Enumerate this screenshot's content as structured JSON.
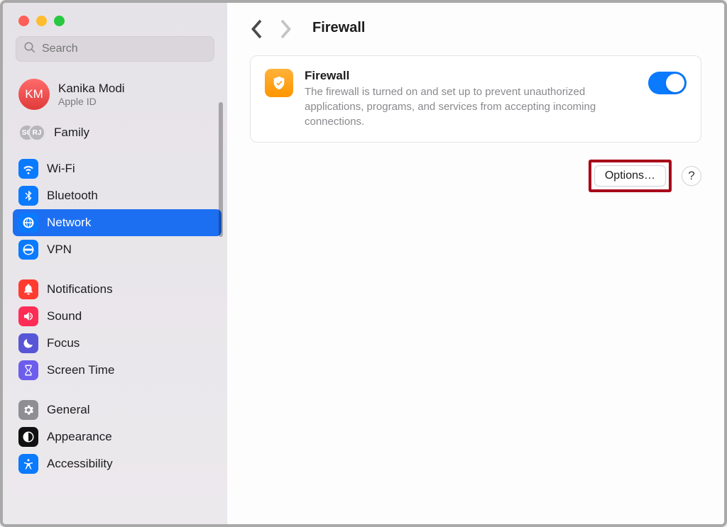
{
  "search": {
    "placeholder": "Search"
  },
  "account": {
    "initials": "KM",
    "name": "Kanika Modi",
    "sub": "Apple ID"
  },
  "family": {
    "label": "Family",
    "badge1": "SG",
    "badge2": "RJ"
  },
  "sidebar": {
    "items": [
      {
        "label": "Wi-Fi"
      },
      {
        "label": "Bluetooth"
      },
      {
        "label": "Network"
      },
      {
        "label": "VPN"
      },
      {
        "label": "Notifications"
      },
      {
        "label": "Sound"
      },
      {
        "label": "Focus"
      },
      {
        "label": "Screen Time"
      },
      {
        "label": "General"
      },
      {
        "label": "Appearance"
      },
      {
        "label": "Accessibility"
      }
    ]
  },
  "header": {
    "title": "Firewall"
  },
  "card": {
    "title": "Firewall",
    "desc": "The firewall is turned on and set up to prevent unauthorized applications, programs, and services from accepting incoming connections."
  },
  "actions": {
    "options": "Options…",
    "help": "?"
  }
}
